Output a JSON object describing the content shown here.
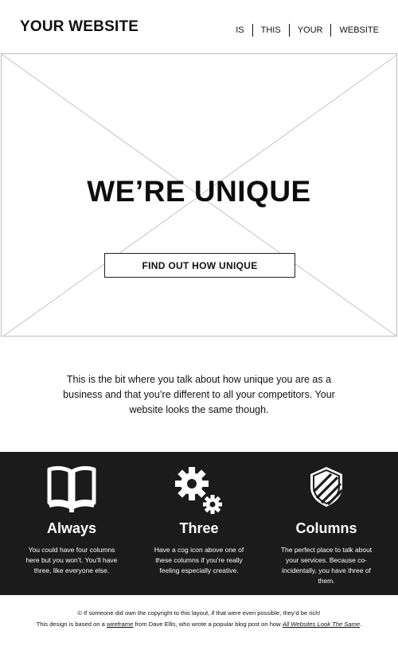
{
  "header": {
    "logo": "YOUR WEBSITE",
    "nav": [
      "IS",
      "THIS",
      "YOUR",
      "WEBSITE"
    ]
  },
  "hero": {
    "title": "WE’RE UNIQUE",
    "button_label": "FIND OUT HOW UNIQUE"
  },
  "intro": {
    "text": "This is the bit where you talk about how unique you are as a business and that you’re different to all your competitors. Your website looks the same though."
  },
  "columns": [
    {
      "icon": "book-icon",
      "title": "Always",
      "text": "You could have four columns here but you won’t. You’ll have three, like everyone else."
    },
    {
      "icon": "cog-icon",
      "title": "Three",
      "text": "Have a cog icon above one of these columns if you’re really feeling especially creative."
    },
    {
      "icon": "shield-icon",
      "title": "Columns",
      "text": "The perfect place to talk about your services. Because co-incidentally, you have three of them."
    }
  ],
  "footer": {
    "line1": "© If someone did own the copyright to this layout, if that were even possible, they’d be rich!",
    "line2_prefix": "This design is based on a",
    "line2_link1": "wireframe",
    "line2_middle": "from Dave Ellis, who wrote a popular blog post on how",
    "line2_link2": "All Websites Look The Same",
    "line2_suffix": "."
  },
  "colors": {
    "dark_band": "#1b1b1b",
    "placeholder_lines": "#bdbdbd"
  }
}
